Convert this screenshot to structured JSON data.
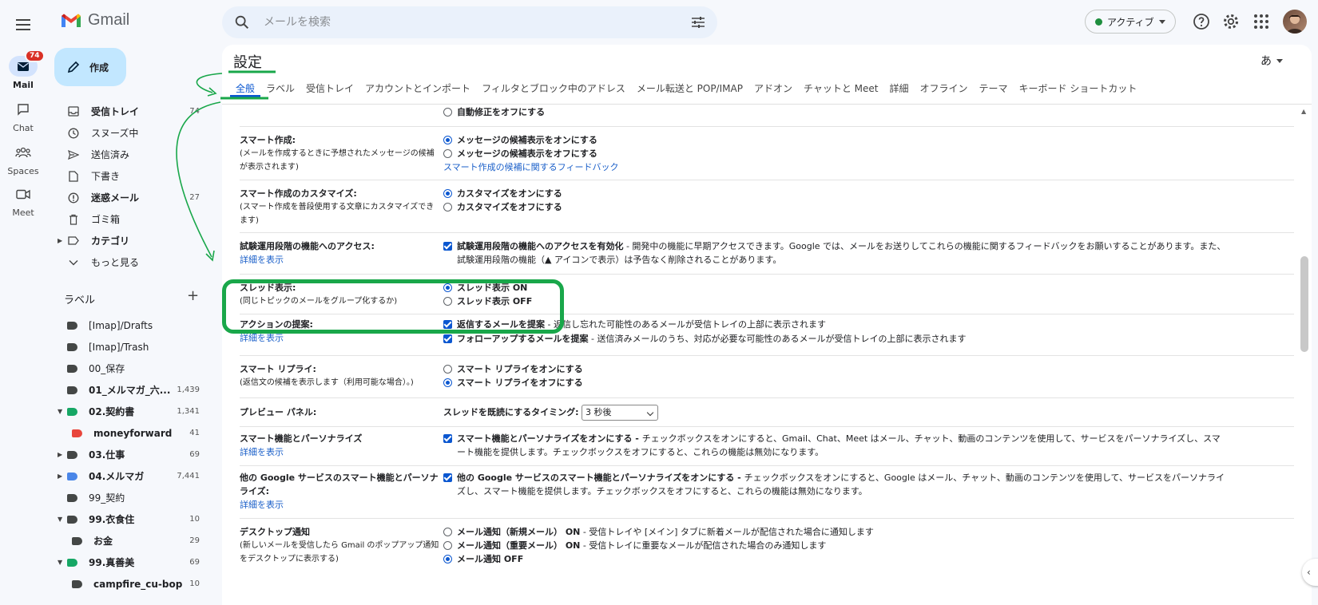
{
  "app": {
    "name": "Gmail"
  },
  "rail": [
    {
      "label": "Mail",
      "icon": "mail-icon",
      "badge": "74",
      "active": true
    },
    {
      "label": "Chat",
      "icon": "chat-icon"
    },
    {
      "label": "Spaces",
      "icon": "spaces-icon"
    },
    {
      "label": "Meet",
      "icon": "meet-icon"
    }
  ],
  "search": {
    "placeholder": "メールを検索"
  },
  "status": {
    "label": "アクティブ",
    "color": "#1e8e3e"
  },
  "compose": {
    "label": "作成"
  },
  "nav": [
    {
      "label": "受信トレイ",
      "count": "74",
      "bold": true,
      "icon": "inbox-icon"
    },
    {
      "label": "スヌーズ中",
      "count": "",
      "bold": false,
      "icon": "snooze-icon"
    },
    {
      "label": "送信済み",
      "count": "",
      "bold": false,
      "icon": "send-icon"
    },
    {
      "label": "下書き",
      "count": "",
      "bold": false,
      "icon": "draft-icon"
    },
    {
      "label": "迷惑メール",
      "count": "27",
      "bold": true,
      "icon": "spam-icon"
    },
    {
      "label": "ゴミ箱",
      "count": "",
      "bold": false,
      "icon": "trash-icon"
    },
    {
      "label": "カテゴリ",
      "count": "",
      "bold": true,
      "icon": "category-icon"
    },
    {
      "label": "もっと見る",
      "count": "",
      "bold": false,
      "icon": "chevron-down-icon"
    }
  ],
  "labels_section": {
    "title": "ラベル"
  },
  "labels": [
    {
      "label": "[Imap]/Drafts",
      "count": "",
      "bold": false,
      "color": "#444746",
      "indent": 0
    },
    {
      "label": "[Imap]/Trash",
      "count": "",
      "bold": false,
      "color": "#444746",
      "indent": 0
    },
    {
      "label": "00_保存",
      "count": "",
      "bold": false,
      "color": "#444746",
      "indent": 0
    },
    {
      "label": "01_メルマガ_六...",
      "count": "1,439",
      "bold": true,
      "color": "#444746",
      "indent": 0
    },
    {
      "label": "02.契約書",
      "count": "1,341",
      "bold": true,
      "color": "#16a765",
      "indent": 0
    },
    {
      "label": "moneyforward",
      "count": "41",
      "bold": true,
      "color": "#e8453c",
      "indent": 1
    },
    {
      "label": "03.仕事",
      "count": "69",
      "bold": true,
      "color": "#444746",
      "indent": 0
    },
    {
      "label": "04.メルマガ",
      "count": "7,441",
      "bold": true,
      "color": "#4a86e8",
      "indent": 0
    },
    {
      "label": "99_契約",
      "count": "",
      "bold": false,
      "color": "#444746",
      "indent": 0
    },
    {
      "label": "99.衣食住",
      "count": "10",
      "bold": true,
      "color": "#444746",
      "indent": 0
    },
    {
      "label": "お金",
      "count": "29",
      "bold": true,
      "color": "#444746",
      "indent": 1
    },
    {
      "label": "99.真善美",
      "count": "69",
      "bold": true,
      "color": "#16a765",
      "indent": 0
    },
    {
      "label": "campfire_cu-bop",
      "count": "10",
      "bold": true,
      "color": "#444746",
      "indent": 1
    }
  ],
  "settings": {
    "title": "設定",
    "lang": "あ",
    "tabs": [
      "全般",
      "ラベル",
      "受信トレイ",
      "アカウントとインポート",
      "フィルタとブロック中のアドレス",
      "メール転送と POP/IMAP",
      "アドオン",
      "チャットと Meet",
      "詳細",
      "オフライン",
      "テーマ",
      "キーボード ショートカット"
    ],
    "autocorrect_off": "自動修正をオフにする",
    "smart_compose": {
      "label": "スマート作成:",
      "desc": "(メールを作成するときに予想されたメッセージの候補が表示されます)",
      "on": "メッセージの候補表示をオンにする",
      "off": "メッセージの候補表示をオフにする",
      "feedback": "スマート作成の候補に関するフィードバック"
    },
    "customize": {
      "label": "スマート作成のカスタマイズ:",
      "desc": "(スマート作成を普段使用する文章にカスタマイズできます)",
      "on": "カスタマイズをオンにする",
      "off": "カスタマイズをオフにする"
    },
    "experimental": {
      "label": "試験運用段階の機能へのアクセス:",
      "link": "詳細を表示",
      "option": "試験運用段階の機能へのアクセスを有効化",
      "text": " - 開発中の機能に早期アクセスできます。Google では、メールをお送りしてこれらの機能に関するフィードバックをお願いすることがあります。また、試験運用段階の機能（",
      "text_after": " アイコンで表示）は予告なく削除されることがあります。"
    },
    "thread": {
      "label": "スレッド表示:",
      "desc": "(同じトピックのメールをグループ化するか)",
      "on": "スレッド表示 ON",
      "off": "スレッド表示 OFF"
    },
    "nudges": {
      "label": "アクションの提案:",
      "link": "詳細を表示",
      "opt1": "返信するメールを提案",
      "opt1_text": " - 返信し忘れた可能性のあるメールが受信トレイの上部に表示されます",
      "opt2": "フォローアップするメールを提案",
      "opt2_text": " - 送信済みメールのうち、対応が必要な可能性のあるメールが受信トレイの上部に表示されます"
    },
    "smart_reply": {
      "label": "スマート リプライ:",
      "desc": "(返信文の候補を表示します（利用可能な場合）。)",
      "on": "スマート リプライをオンにする",
      "off": "スマート リプライをオフにする"
    },
    "preview": {
      "label": "プレビュー パネル:",
      "timing": "スレッドを既読にするタイミング:",
      "value": "3 秒後"
    },
    "smart_features": {
      "label": "スマート機能とパーソナライズ",
      "link": "詳細を表示",
      "option": "スマート機能とパーソナライズをオンにする - ",
      "text": "チェックボックスをオンにすると、Gmail、Chat、Meet はメール、チャット、動画のコンテンツを使用して、サービスをパーソナライズし、スマート機能を提供します。チェックボックスをオフにすると、これらの機能は無効になります。"
    },
    "other_google": {
      "label": "他の Google サービスのスマート機能とパーソナライズ:",
      "link": "詳細を表示",
      "option": "他の Google サービスのスマート機能とパーソナライズをオンにする - ",
      "text": "チェックボックスをオンにすると、Google はメール、チャット、動画のコンテンツを使用して、サービスをパーソナライズし、スマート機能を提供します。チェックボックスをオフにすると、これらの機能は無効になります。"
    },
    "desktop": {
      "label": "デスクトップ通知",
      "desc": "(新しいメールを受信したら Gmail のポップアップ通知をデスクトップに表示する)",
      "opt1": "メール通知（新規メール） ON",
      "opt1_text": " - 受信トレイや [メイン] タブに新着メールが配信された場合に通知します",
      "opt2": "メール通知（重要メール） ON",
      "opt2_text": " - 受信トレイに重要なメールが配信された場合のみ通知します",
      "opt3": "メール通知 OFF"
    }
  },
  "colors": {
    "accent": "#0b57d0",
    "annotation": "#19a74a"
  }
}
